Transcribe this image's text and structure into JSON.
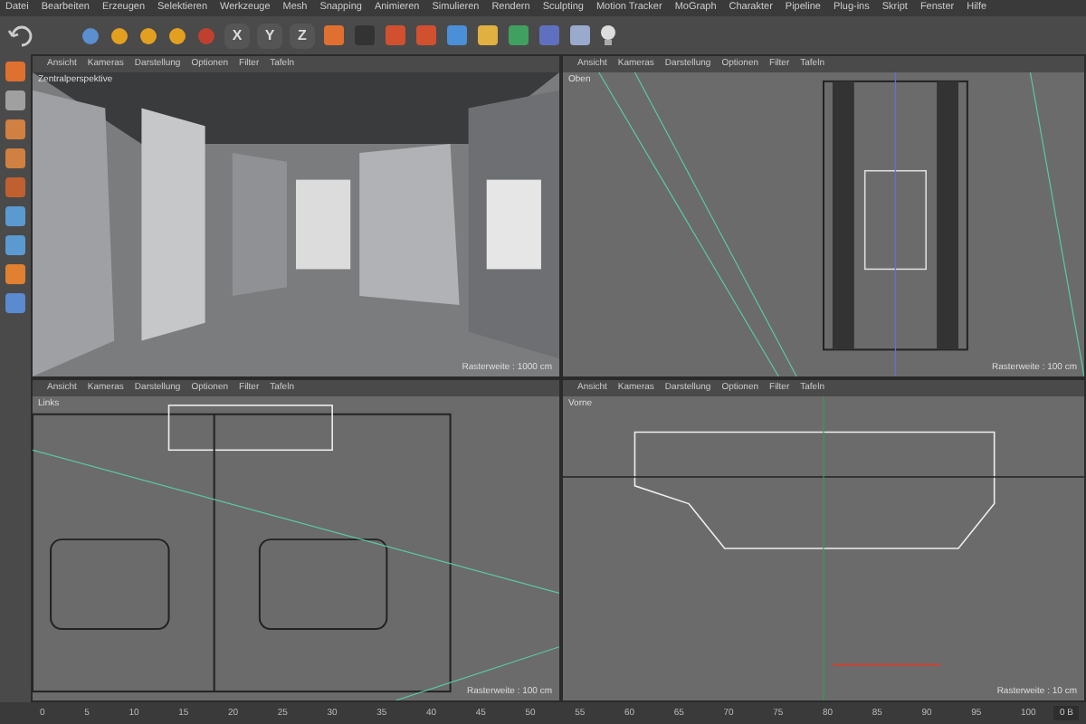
{
  "menu": [
    "Datei",
    "Bearbeiten",
    "Erzeugen",
    "Selektieren",
    "Werkzeuge",
    "Mesh",
    "Snapping",
    "Animieren",
    "Simulieren",
    "Rendern",
    "Sculpting",
    "Motion Tracker",
    "MoGraph",
    "Charakter",
    "Pipeline",
    "Plug-ins",
    "Skript",
    "Fenster",
    "Hilfe"
  ],
  "axis_buttons": [
    "X",
    "Y",
    "Z"
  ],
  "viewports": [
    {
      "kind": "perspective",
      "menu": [
        "Ansicht",
        "Kameras",
        "Darstellung",
        "Optionen",
        "Filter",
        "Tafeln"
      ],
      "title": "Zentralperspektive",
      "grid": "Rasterweite : 1000 cm"
    },
    {
      "kind": "top",
      "menu": [
        "Ansicht",
        "Kameras",
        "Darstellung",
        "Optionen",
        "Filter",
        "Tafeln"
      ],
      "title": "Oben",
      "grid": "Rasterweite : 100 cm"
    },
    {
      "kind": "left",
      "menu": [
        "Ansicht",
        "Kameras",
        "Darstellung",
        "Optionen",
        "Filter",
        "Tafeln"
      ],
      "title": "Links",
      "grid": "Rasterweite : 100 cm"
    },
    {
      "kind": "front",
      "menu": [
        "Ansicht",
        "Kameras",
        "Darstellung",
        "Optionen",
        "Filter",
        "Tafeln"
      ],
      "title": "Vorne",
      "grid": "Rasterweite : 10 cm"
    }
  ],
  "timeline": {
    "ticks": [
      "0",
      "5",
      "10",
      "15",
      "20",
      "25",
      "30",
      "35",
      "40",
      "45",
      "50",
      "55",
      "60",
      "65",
      "70",
      "75",
      "80",
      "85",
      "90",
      "95",
      "100"
    ],
    "frame": "0 B"
  }
}
